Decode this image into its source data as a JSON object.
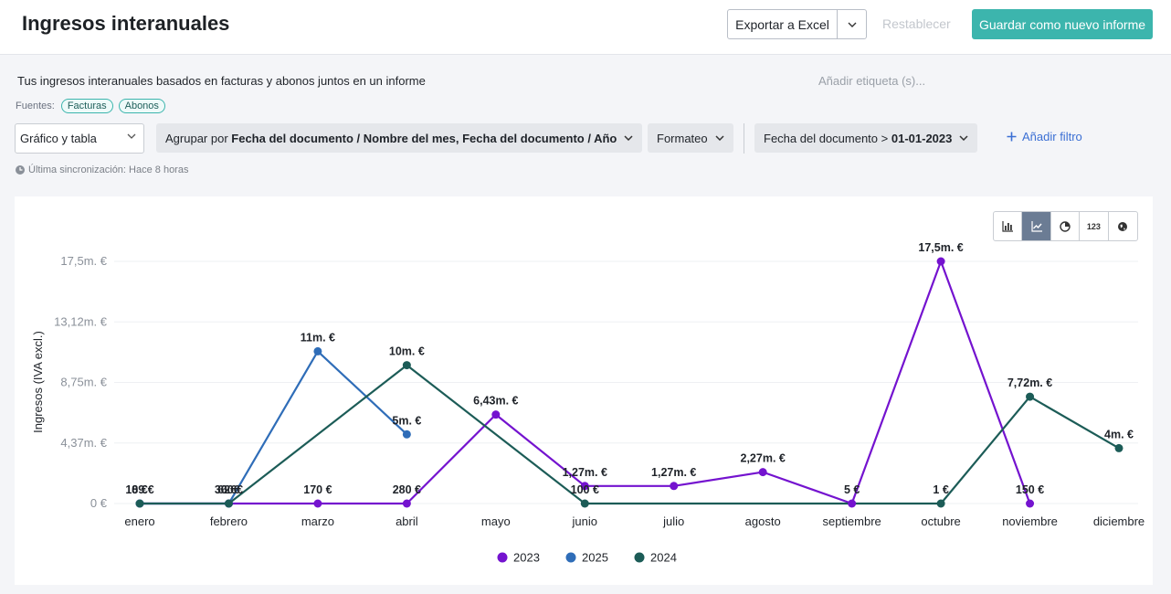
{
  "header": {
    "title": "Ingresos interanuales",
    "export_label": "Exportar a Excel",
    "reset_label": "Restablecer",
    "save_label": "Guardar como nuevo informe"
  },
  "report": {
    "description": "Tus ingresos interanuales basados en facturas y abonos juntos en un informe",
    "tag_placeholder": "Añadir etiqueta (s)...",
    "sources_label": "Fuentes:",
    "sources": [
      "Facturas",
      "Abonos"
    ]
  },
  "toolbar": {
    "view_select": "Gráfico y tabla",
    "group_prefix": "Agrupar por ",
    "group_value": "Fecha del documento / Nombre del mes, Fecha del documento / Año",
    "format_label": "Formateo",
    "filter_prefix": "Fecha del documento > ",
    "filter_value": "01-01-2023",
    "add_filter_label": "Añadir filtro"
  },
  "sync_text": "Última sincronización: Hace 8 horas",
  "view_toggles": [
    {
      "icon": "bar-chart-icon",
      "active": false
    },
    {
      "icon": "line-chart-icon",
      "active": true
    },
    {
      "icon": "pie-chart-icon",
      "active": false
    },
    {
      "icon": "number-icon",
      "label": "123",
      "active": false
    },
    {
      "icon": "map-icon",
      "active": false
    }
  ],
  "chart_data": {
    "type": "line",
    "ylabel": "Ingresos (IVA excl.)",
    "ylim": [
      0,
      17500000
    ],
    "yticks": [
      {
        "v": 0,
        "label": "0 €"
      },
      {
        "v": 4375000,
        "label": "4,37m. €"
      },
      {
        "v": 8750000,
        "label": "8,75m. €"
      },
      {
        "v": 13125000,
        "label": "13,12m. €"
      },
      {
        "v": 17500000,
        "label": "17,5m. €"
      }
    ],
    "categories": [
      "enero",
      "febrero",
      "marzo",
      "abril",
      "mayo",
      "junio",
      "julio",
      "agosto",
      "septiembre",
      "octubre",
      "noviembre",
      "diciembre"
    ],
    "grid": true,
    "legend_position": "bottom",
    "series": [
      {
        "name": "2023",
        "color": "#7413cf",
        "values": [
          189,
          62,
          170,
          280,
          6430000,
          1270000,
          1270000,
          2270000,
          5,
          17500000,
          150,
          null
        ],
        "labels": [
          "189 €",
          "62 €",
          "170 €",
          "280 €",
          "6,43m. €",
          "1,27m. €",
          "1,27m. €",
          "2,27m. €",
          "5 €",
          "17,5m. €",
          "150 €",
          null
        ]
      },
      {
        "name": "2025",
        "color": "#2f6db8",
        "values": [
          0,
          0,
          11000000,
          5000000,
          null,
          null,
          null,
          null,
          null,
          null,
          null,
          null
        ],
        "labels": [
          "0 €",
          "0 €",
          "11m. €",
          "5m. €",
          null,
          null,
          null,
          null,
          null,
          null,
          null,
          null
        ]
      },
      {
        "name": "2024",
        "color": "#1c5c57",
        "values": [
          0,
          360,
          null,
          10000000,
          null,
          100,
          null,
          null,
          null,
          1,
          7720000,
          4000000
        ],
        "labels": [
          "0 €",
          "360 €",
          null,
          "10m. €",
          null,
          "100 €",
          null,
          null,
          null,
          "1 €",
          "7,72m. €",
          "4m. €"
        ]
      }
    ]
  }
}
